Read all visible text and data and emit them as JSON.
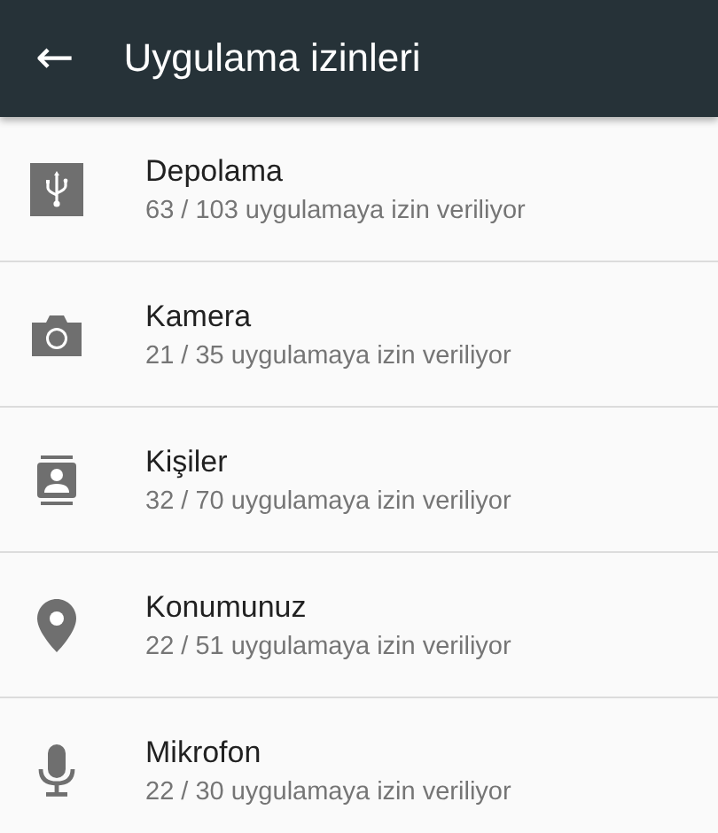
{
  "toolbar": {
    "back_icon": "←",
    "title": "Uygulama izinleri"
  },
  "permissions": [
    {
      "kind": "storage",
      "name": "Depolama",
      "summary": "63 / 103 uygulamaya izin veriliyor"
    },
    {
      "kind": "camera",
      "name": "Kamera",
      "summary": "21 / 35 uygulamaya izin veriliyor"
    },
    {
      "kind": "contacts",
      "name": "Kişiler",
      "summary": "32 / 70 uygulamaya izin veriliyor"
    },
    {
      "kind": "location",
      "name": "Konumunuz",
      "summary": "22 / 51 uygulamaya izin veriliyor"
    },
    {
      "kind": "microphone",
      "name": "Mikrofon",
      "summary": "22 / 30 uygulamaya izin veriliyor"
    }
  ]
}
